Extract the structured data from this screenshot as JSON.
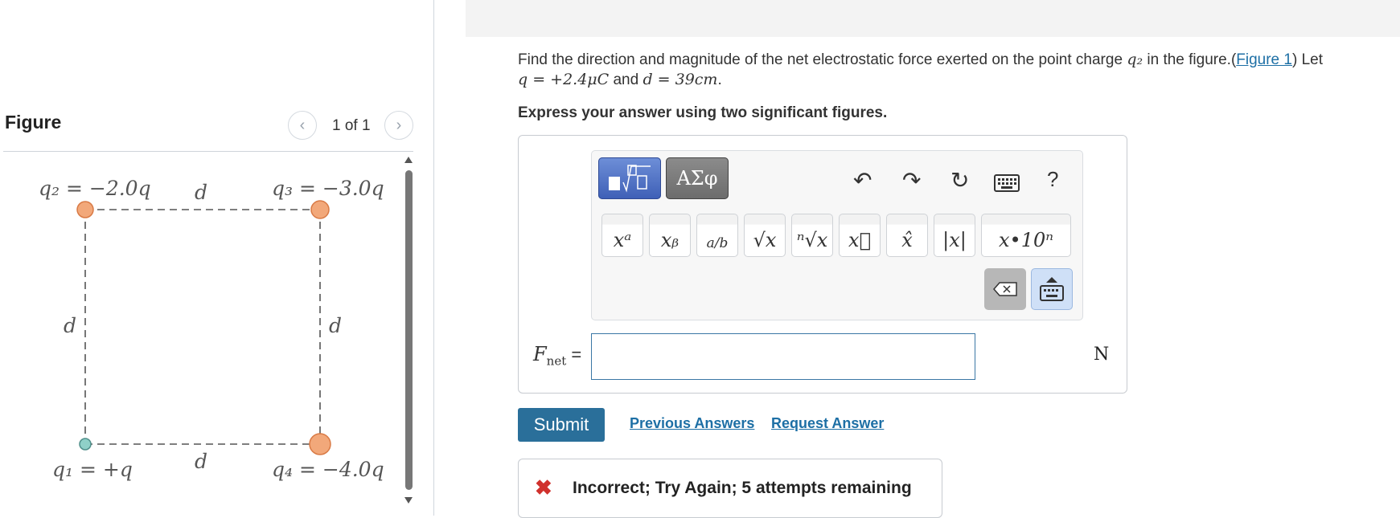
{
  "figure_panel": {
    "title": "Figure",
    "pager": "1 of 1",
    "labels": {
      "q2": "q₂ = −2.0q",
      "q3": "q₃ = −3.0q",
      "q1": "q₁ = +q",
      "q4": "q₄ = −4.0q",
      "d": "d"
    }
  },
  "question": {
    "text_before_q2": "Find the direction and magnitude of the net electrostatic force exerted on the point charge ",
    "q2_symbol": "q₂",
    "text_after_q2": " in the figure.(",
    "figure_link": "Figure 1",
    "text_let": ") Let",
    "q_value": "q = +2.4μC",
    "and_text": " and ",
    "d_value": "d = 39cm",
    "period": "."
  },
  "instruction": "Express your answer using two significant figures.",
  "toolbar": {
    "symbols_label": "ΑΣφ",
    "help": "?",
    "keys": [
      "xᵃ",
      "xᵦ",
      "a/b",
      "√x",
      "ⁿ√x",
      "x⃗",
      "x̂",
      "|x|",
      "x•10ⁿ"
    ]
  },
  "answer": {
    "label_F": "F",
    "label_sub": "net",
    "equals": " =",
    "value": "",
    "unit": "N"
  },
  "buttons": {
    "submit": "Submit",
    "previous_answers": "Previous Answers",
    "request_answer": "Request Answer"
  },
  "feedback": {
    "icon": "✖",
    "text": "Incorrect; Try Again; 5 attempts remaining"
  }
}
